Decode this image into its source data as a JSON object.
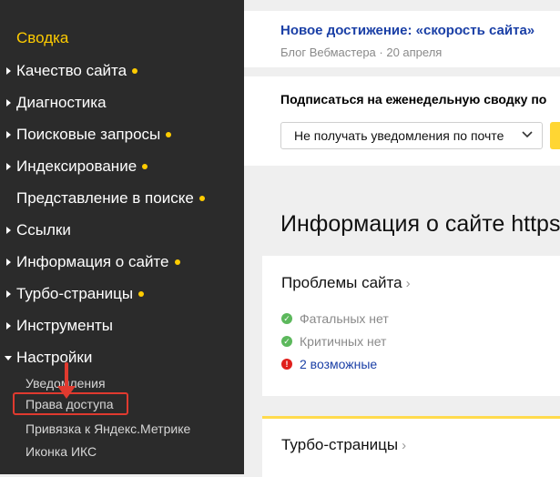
{
  "sidebar": {
    "active_item": "Сводка",
    "items": [
      {
        "label": "Качество сайта",
        "dot": true,
        "expanded": false
      },
      {
        "label": "Диагностика",
        "dot": false,
        "expanded": false
      },
      {
        "label": "Поисковые запросы",
        "dot": true,
        "expanded": false
      },
      {
        "label": "Индексирование",
        "dot": true,
        "expanded": false
      },
      {
        "label": "Представление в поиске",
        "dot": true,
        "expanded": false,
        "no_arrow": true
      },
      {
        "label": "Ссылки",
        "dot": false,
        "expanded": false
      },
      {
        "label": "Информация о сайте",
        "dot": true,
        "expanded": false
      },
      {
        "label": "Турбо-страницы",
        "dot": true,
        "expanded": false
      },
      {
        "label": "Инструменты",
        "dot": false,
        "expanded": false
      },
      {
        "label": "Настройки",
        "dot": false,
        "expanded": true
      }
    ],
    "sub_items": [
      {
        "label": "Уведомления"
      },
      {
        "label": "Права доступа",
        "highlighted": true
      },
      {
        "label": "Привязка к Яндекс.Метрике"
      },
      {
        "label": "Иконка ИКС"
      }
    ],
    "colors": {
      "background": "#2b2b2b",
      "active": "#ffcc00",
      "highlight": "#e03a2f"
    }
  },
  "news": {
    "title": "Новое достижение: «скорость сайта»",
    "meta": "Блог Вебмастера · 20 апреля"
  },
  "subscribe": {
    "label": "Подписаться на еженедельную сводку по",
    "select_value": "Не получать уведомления по почте"
  },
  "page_title": "Информация о сайте https:/",
  "problems": {
    "heading": "Проблемы сайта",
    "rows": [
      {
        "text": "Фатальных нет",
        "status": "ok"
      },
      {
        "text": "Критичных нет",
        "status": "ok"
      },
      {
        "text": "2 возможные",
        "status": "error"
      }
    ]
  },
  "turbo": {
    "heading": "Турбо-страницы"
  },
  "icons": {
    "ok": "check-circle-icon",
    "error": "exclamation-circle-icon",
    "chevron": "chevron-down-icon",
    "arrow": "red-annotation-arrow"
  }
}
